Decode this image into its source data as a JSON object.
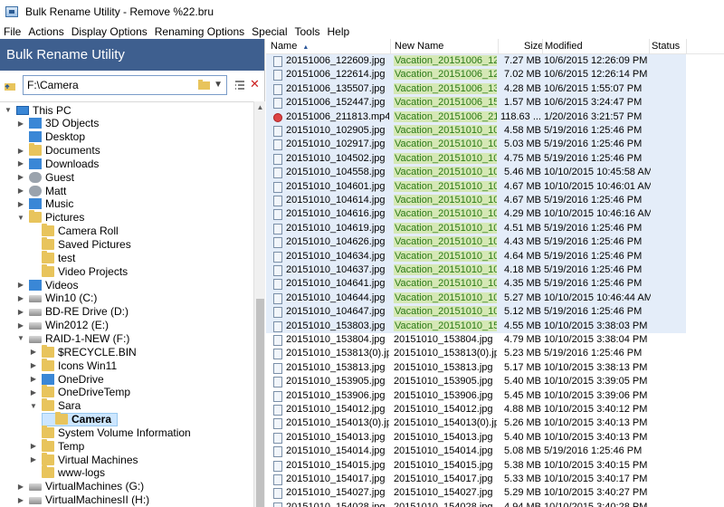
{
  "window": {
    "title": "Bulk Rename Utility - Remove %22.bru"
  },
  "menu": [
    "File",
    "Actions",
    "Display Options",
    "Renaming Options",
    "Special",
    "Tools",
    "Help"
  ],
  "app_header": "Bulk Rename Utility",
  "path_input": {
    "value": "F:\\Camera"
  },
  "tree": [
    {
      "label": "This PC",
      "indent": 0,
      "chev": "v",
      "icon": "pc"
    },
    {
      "label": "3D Objects",
      "indent": 1,
      "chev": ">",
      "icon": "blue"
    },
    {
      "label": "Desktop",
      "indent": 1,
      "chev": "",
      "icon": "blue"
    },
    {
      "label": "Documents",
      "indent": 1,
      "chev": ">",
      "icon": "fold"
    },
    {
      "label": "Downloads",
      "indent": 1,
      "chev": ">",
      "icon": "blue"
    },
    {
      "label": "Guest",
      "indent": 1,
      "chev": ">",
      "icon": "gray"
    },
    {
      "label": "Matt",
      "indent": 1,
      "chev": ">",
      "icon": "gray"
    },
    {
      "label": "Music",
      "indent": 1,
      "chev": ">",
      "icon": "blue"
    },
    {
      "label": "Pictures",
      "indent": 1,
      "chev": "v",
      "icon": "fold"
    },
    {
      "label": "Camera Roll",
      "indent": 2,
      "chev": "",
      "icon": "fold"
    },
    {
      "label": "Saved Pictures",
      "indent": 2,
      "chev": "",
      "icon": "fold"
    },
    {
      "label": "test",
      "indent": 2,
      "chev": "",
      "icon": "fold"
    },
    {
      "label": "Video Projects",
      "indent": 2,
      "chev": "",
      "icon": "fold"
    },
    {
      "label": "Videos",
      "indent": 1,
      "chev": ">",
      "icon": "blue"
    },
    {
      "label": "Win10 (C:)",
      "indent": 1,
      "chev": ">",
      "icon": "drive"
    },
    {
      "label": "BD-RE Drive (D:)",
      "indent": 1,
      "chev": ">",
      "icon": "drive"
    },
    {
      "label": "Win2012 (E:)",
      "indent": 1,
      "chev": ">",
      "icon": "drive"
    },
    {
      "label": "RAID-1-NEW (F:)",
      "indent": 1,
      "chev": "v",
      "icon": "drive"
    },
    {
      "label": "$RECYCLE.BIN",
      "indent": 2,
      "chev": ">",
      "icon": "fold"
    },
    {
      "label": "Icons Win11",
      "indent": 2,
      "chev": ">",
      "icon": "fold"
    },
    {
      "label": "OneDrive",
      "indent": 2,
      "chev": ">",
      "icon": "blue"
    },
    {
      "label": "OneDriveTemp",
      "indent": 2,
      "chev": ">",
      "icon": "fold"
    },
    {
      "label": "Sara",
      "indent": 2,
      "chev": "v",
      "icon": "fold"
    },
    {
      "label": "Camera",
      "indent": 3,
      "chev": "",
      "icon": "fold",
      "selected": true
    },
    {
      "label": "System Volume Information",
      "indent": 2,
      "chev": "",
      "icon": "fold"
    },
    {
      "label": "Temp",
      "indent": 2,
      "chev": ">",
      "icon": "fold"
    },
    {
      "label": "Virtual Machines",
      "indent": 2,
      "chev": ">",
      "icon": "fold"
    },
    {
      "label": "www-logs",
      "indent": 2,
      "chev": "",
      "icon": "fold"
    },
    {
      "label": "VirtualMachines (G:)",
      "indent": 1,
      "chev": ">",
      "icon": "drive"
    },
    {
      "label": "VirtualMachinesII (H:)",
      "indent": 1,
      "chev": ">",
      "icon": "drive"
    },
    {
      "label": "",
      "indent": 1,
      "chev": ">",
      "icon": "drive"
    }
  ],
  "columns": {
    "name": "Name",
    "new_name": "New Name",
    "size": "Size",
    "modified": "Modified",
    "status": "Status"
  },
  "files": [
    {
      "name": "20151006_122609.jpg",
      "new": "Vacation_20151006_122...",
      "size": "7.27 MB",
      "mod": "10/6/2015 12:26:09 PM",
      "sel": true
    },
    {
      "name": "20151006_122614.jpg",
      "new": "Vacation_20151006_122...",
      "size": "7.02 MB",
      "mod": "10/6/2015 12:26:14 PM",
      "sel": true
    },
    {
      "name": "20151006_135507.jpg",
      "new": "Vacation_20151006_135...",
      "size": "4.28 MB",
      "mod": "10/6/2015 1:55:07 PM",
      "sel": true
    },
    {
      "name": "20151006_152447.jpg",
      "new": "Vacation_20151006_152...",
      "size": "1.57 MB",
      "mod": "10/6/2015 3:24:47 PM",
      "sel": true
    },
    {
      "name": "20151006_211813.mp4",
      "new": "Vacation_20151006_211...",
      "size": "118.63 ...",
      "mod": "1/20/2016 3:21:57 PM",
      "sel": true,
      "video": true
    },
    {
      "name": "20151010_102905.jpg",
      "new": "Vacation_20151010_102...",
      "size": "4.58 MB",
      "mod": "5/19/2016 1:25:46 PM",
      "sel": true
    },
    {
      "name": "20151010_102917.jpg",
      "new": "Vacation_20151010_102...",
      "size": "5.03 MB",
      "mod": "5/19/2016 1:25:46 PM",
      "sel": true
    },
    {
      "name": "20151010_104502.jpg",
      "new": "Vacation_20151010_104...",
      "size": "4.75 MB",
      "mod": "5/19/2016 1:25:46 PM",
      "sel": true
    },
    {
      "name": "20151010_104558.jpg",
      "new": "Vacation_20151010_104...",
      "size": "5.46 MB",
      "mod": "10/10/2015 10:45:58 AM",
      "sel": true
    },
    {
      "name": "20151010_104601.jpg",
      "new": "Vacation_20151010_104...",
      "size": "4.67 MB",
      "mod": "10/10/2015 10:46:01 AM",
      "sel": true
    },
    {
      "name": "20151010_104614.jpg",
      "new": "Vacation_20151010_104...",
      "size": "4.67 MB",
      "mod": "5/19/2016 1:25:46 PM",
      "sel": true
    },
    {
      "name": "20151010_104616.jpg",
      "new": "Vacation_20151010_104...",
      "size": "4.29 MB",
      "mod": "10/10/2015 10:46:16 AM",
      "sel": true
    },
    {
      "name": "20151010_104619.jpg",
      "new": "Vacation_20151010_104...",
      "size": "4.51 MB",
      "mod": "5/19/2016 1:25:46 PM",
      "sel": true
    },
    {
      "name": "20151010_104626.jpg",
      "new": "Vacation_20151010_104...",
      "size": "4.43 MB",
      "mod": "5/19/2016 1:25:46 PM",
      "sel": true
    },
    {
      "name": "20151010_104634.jpg",
      "new": "Vacation_20151010_104...",
      "size": "4.64 MB",
      "mod": "5/19/2016 1:25:46 PM",
      "sel": true
    },
    {
      "name": "20151010_104637.jpg",
      "new": "Vacation_20151010_104...",
      "size": "4.18 MB",
      "mod": "5/19/2016 1:25:46 PM",
      "sel": true
    },
    {
      "name": "20151010_104641.jpg",
      "new": "Vacation_20151010_104...",
      "size": "4.35 MB",
      "mod": "5/19/2016 1:25:46 PM",
      "sel": true
    },
    {
      "name": "20151010_104644.jpg",
      "new": "Vacation_20151010_104...",
      "size": "5.27 MB",
      "mod": "10/10/2015 10:46:44 AM",
      "sel": true
    },
    {
      "name": "20151010_104647.jpg",
      "new": "Vacation_20151010_104...",
      "size": "5.12 MB",
      "mod": "5/19/2016 1:25:46 PM",
      "sel": true
    },
    {
      "name": "20151010_153803.jpg",
      "new": "Vacation_20151010_153...",
      "size": "4.55 MB",
      "mod": "10/10/2015 3:38:03 PM",
      "sel": true
    },
    {
      "name": "20151010_153804.jpg",
      "new": "20151010_153804.jpg",
      "size": "4.79 MB",
      "mod": "10/10/2015 3:38:04 PM"
    },
    {
      "name": "20151010_153813(0).jpg",
      "new": "20151010_153813(0).jpg",
      "size": "5.23 MB",
      "mod": "5/19/2016 1:25:46 PM"
    },
    {
      "name": "20151010_153813.jpg",
      "new": "20151010_153813.jpg",
      "size": "5.17 MB",
      "mod": "10/10/2015 3:38:13 PM"
    },
    {
      "name": "20151010_153905.jpg",
      "new": "20151010_153905.jpg",
      "size": "5.40 MB",
      "mod": "10/10/2015 3:39:05 PM"
    },
    {
      "name": "20151010_153906.jpg",
      "new": "20151010_153906.jpg",
      "size": "5.45 MB",
      "mod": "10/10/2015 3:39:06 PM"
    },
    {
      "name": "20151010_154012.jpg",
      "new": "20151010_154012.jpg",
      "size": "4.88 MB",
      "mod": "10/10/2015 3:40:12 PM"
    },
    {
      "name": "20151010_154013(0).jpg",
      "new": "20151010_154013(0).jpg",
      "size": "5.26 MB",
      "mod": "10/10/2015 3:40:13 PM"
    },
    {
      "name": "20151010_154013.jpg",
      "new": "20151010_154013.jpg",
      "size": "5.40 MB",
      "mod": "10/10/2015 3:40:13 PM"
    },
    {
      "name": "20151010_154014.jpg",
      "new": "20151010_154014.jpg",
      "size": "5.08 MB",
      "mod": "5/19/2016 1:25:46 PM"
    },
    {
      "name": "20151010_154015.jpg",
      "new": "20151010_154015.jpg",
      "size": "5.38 MB",
      "mod": "10/10/2015 3:40:15 PM"
    },
    {
      "name": "20151010_154017.jpg",
      "new": "20151010_154017.jpg",
      "size": "5.33 MB",
      "mod": "10/10/2015 3:40:17 PM"
    },
    {
      "name": "20151010_154027.jpg",
      "new": "20151010_154027.jpg",
      "size": "5.29 MB",
      "mod": "10/10/2015 3:40:27 PM"
    },
    {
      "name": "20151010_154028.jpg",
      "new": "20151010_154028.jpg",
      "size": "4.94 MB",
      "mod": "10/10/2015 3:40:28 PM"
    }
  ],
  "colors": {
    "header_bg": "#3e5f8f",
    "selected_row": "#e4edf9",
    "new_name_highlight": "#d5e8b5"
  }
}
